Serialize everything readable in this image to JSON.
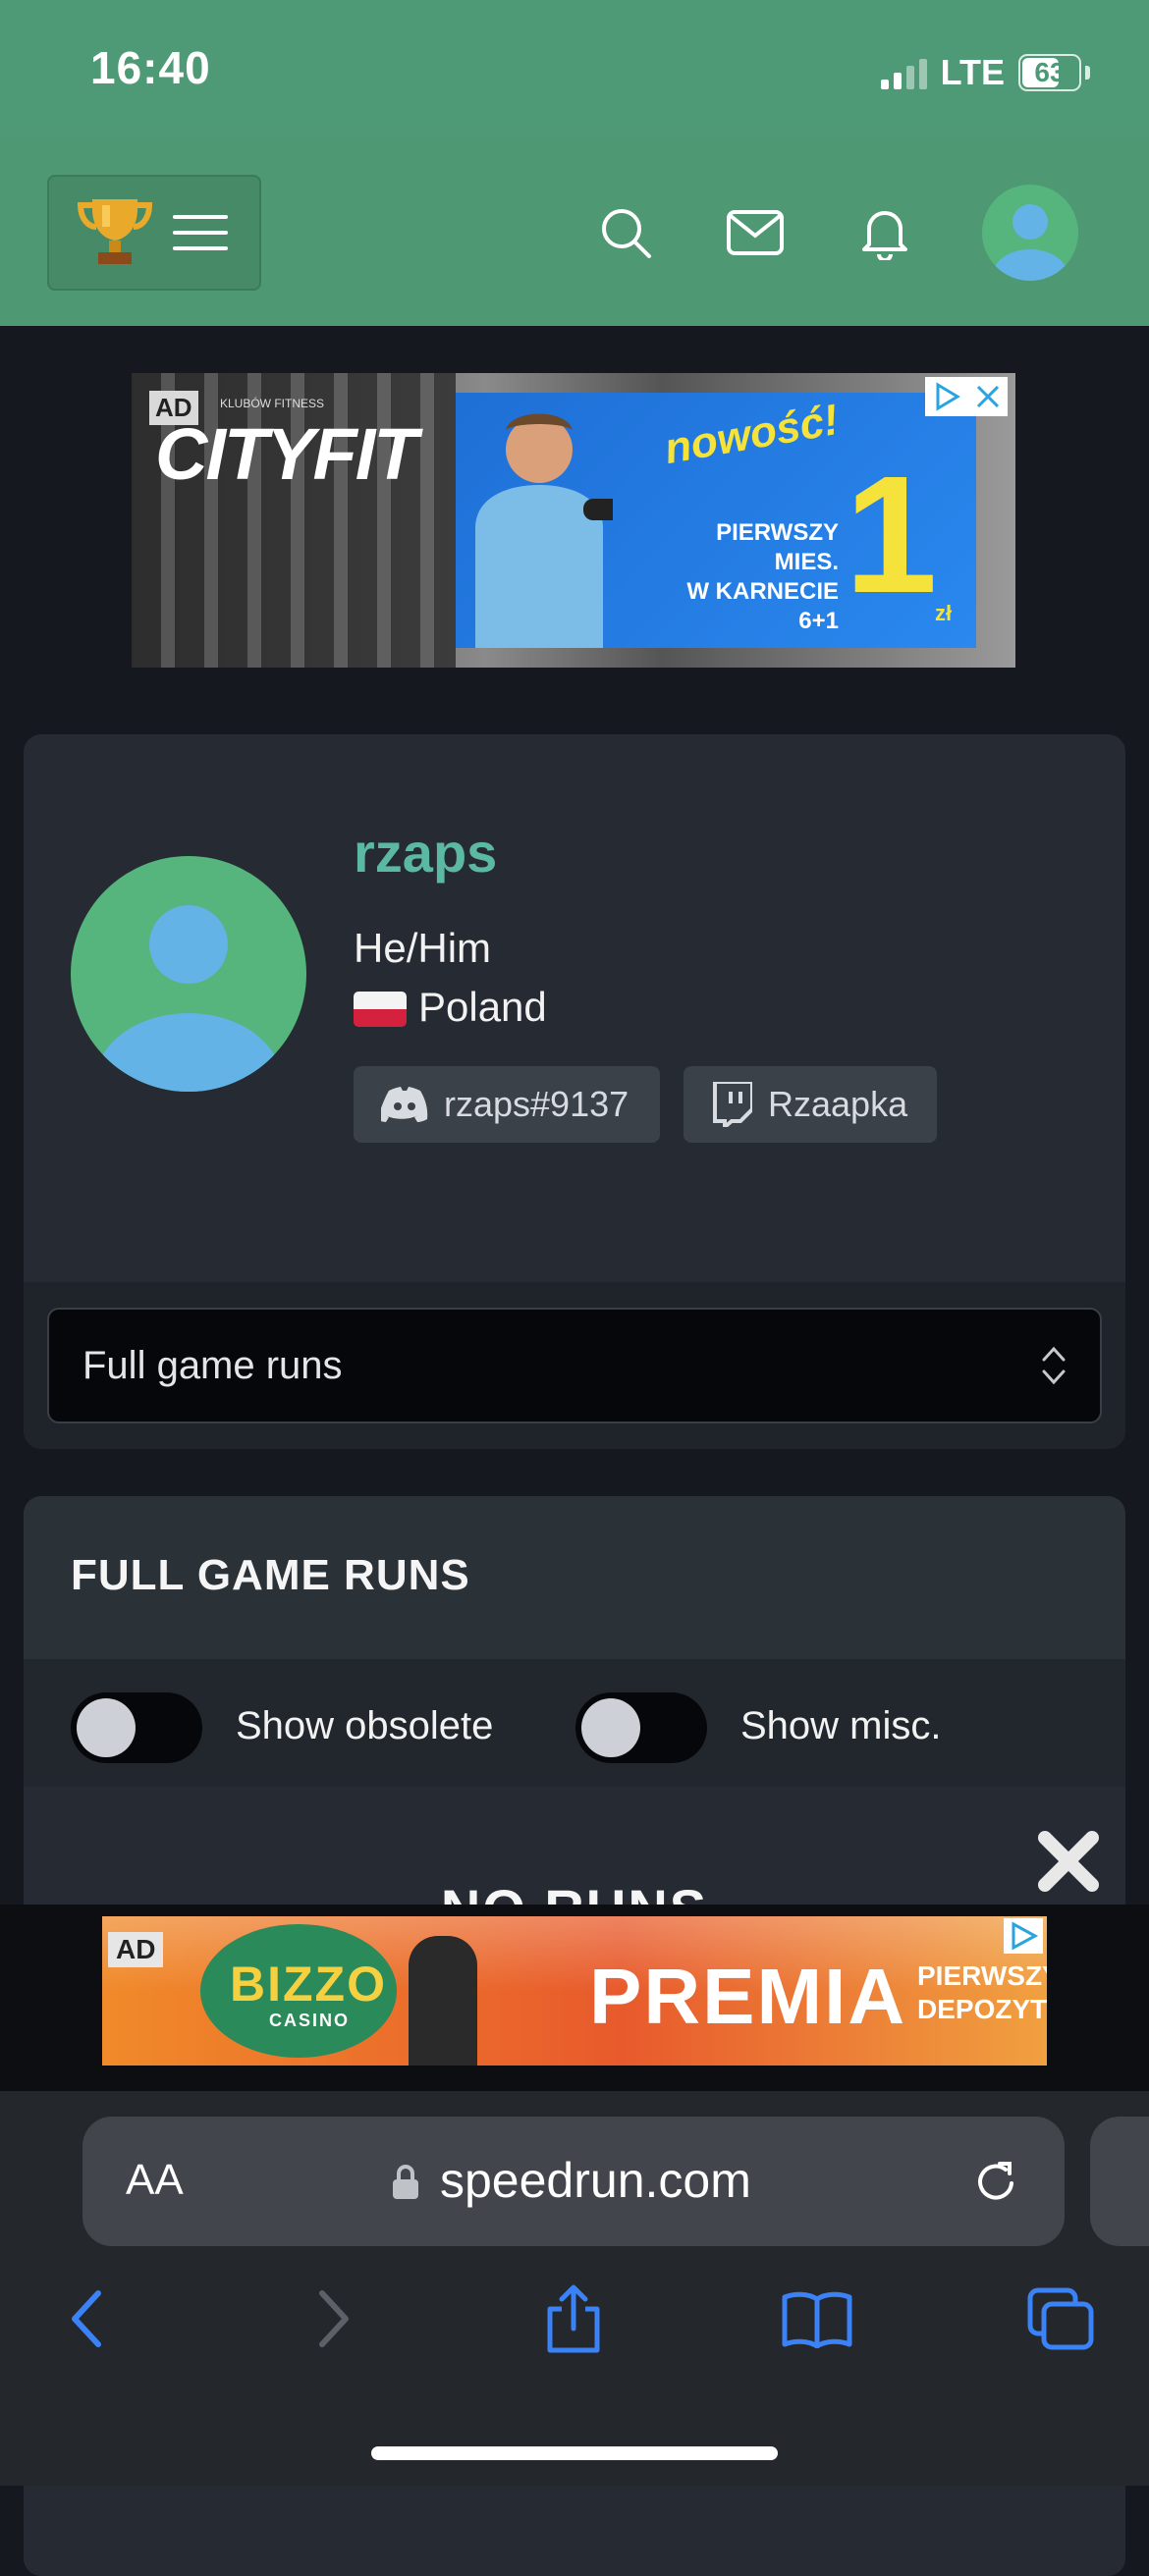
{
  "status_bar": {
    "time": "16:40",
    "network": "LTE",
    "battery": "63"
  },
  "navbar": {
    "icons": [
      "trophy-icon",
      "hamburger-icon",
      "search-icon",
      "mail-icon",
      "bell-icon",
      "avatar"
    ]
  },
  "ad_top": {
    "badge": "AD",
    "brand": "CITYFIT",
    "brand_small": "KLUBÓW FITNESS",
    "headline": "nowość!",
    "line1": "PIERWSZY",
    "line2": "MIES.",
    "line3": "W KARNECIE",
    "line4": "6+1",
    "price": "1",
    "currency": "zł"
  },
  "profile": {
    "username": "rzaps",
    "pronouns": "He/Him",
    "country": "Poland",
    "discord": "rzaps#9137",
    "twitch": "Rzaapka",
    "select_label": "Full game runs"
  },
  "runs": {
    "title": "FULL GAME RUNS",
    "toggle1": "Show obsolete",
    "toggle2": "Show misc.",
    "empty": "NO RUNS"
  },
  "ad_bottom": {
    "badge": "AD",
    "brand": "BIZZO",
    "brand_sub": "CASINO",
    "headline": "PREMIA",
    "side1": "PIERWSZY",
    "side2": "DEPOZYT"
  },
  "browser": {
    "text_size": "AA",
    "url": "speedrun.com"
  },
  "colors": {
    "brand_green": "#4f9a76",
    "username": "#5ab8a4",
    "card_bg": "#262b33",
    "safari_blue": "#3b82f6"
  }
}
